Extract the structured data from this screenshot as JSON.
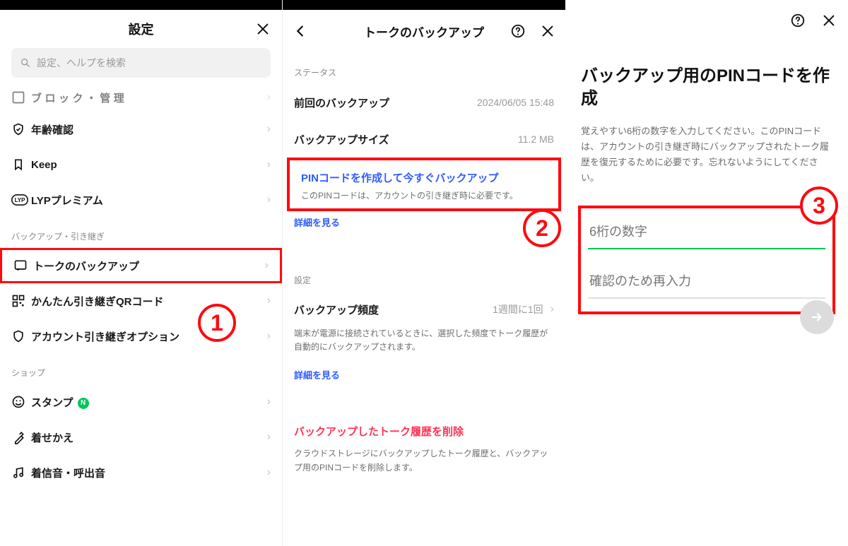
{
  "panel1": {
    "title": "設定",
    "search_placeholder": "設定、ヘルプを検索",
    "items_top": [
      {
        "icon": "blocked-icon",
        "label": "ブロック・管理"
      },
      {
        "icon": "shield-icon",
        "label": "年齢確認"
      },
      {
        "icon": "bookmark-icon",
        "label": "Keep"
      },
      {
        "icon": "lyp-icon",
        "label": "LYPプレミアム"
      }
    ],
    "section_backup_cap": "バックアップ・引き継ぎ",
    "items_backup": [
      {
        "icon": "chat-backup-icon",
        "label": "トークのバックアップ",
        "highlight": true
      },
      {
        "icon": "qr-icon",
        "label": "かんたん引き継ぎQRコード"
      },
      {
        "icon": "shield2-icon",
        "label": "アカウント引き継ぎオプション"
      }
    ],
    "section_shop_cap": "ショップ",
    "items_shop": [
      {
        "icon": "smile-icon",
        "label": "スタンプ",
        "badge": "N"
      },
      {
        "icon": "palette-icon",
        "label": "着せかえ"
      },
      {
        "icon": "music-icon",
        "label": "着信音・呼出音"
      }
    ]
  },
  "panel2": {
    "title": "トークのバックアップ",
    "status_cap": "ステータス",
    "last_label": "前回のバックアップ",
    "last_value": "2024/06/05 15:48",
    "size_label": "バックアップサイズ",
    "size_value": "11.2 MB",
    "action_title": "PINコードを作成して今すぐバックアップ",
    "action_sub": "このPINコードは、アカウントの引き継ぎ時に必要です。",
    "more_link": "詳細を見る",
    "settings_cap": "設定",
    "freq_label": "バックアップ頻度",
    "freq_value": "1週間に1回",
    "freq_desc": "端末が電源に接続されているときに、選択した頻度でトーク履歴が自動的にバックアップされます。",
    "more_link_2": "詳細を見る",
    "delete_title": "バックアップしたトーク履歴を削除",
    "delete_desc": "クラウドストレージにバックアップしたトーク履歴と、バックアップ用のPINコードを削除します。"
  },
  "panel3": {
    "heading": "バックアップ用のPINコードを作成",
    "desc": "覚えやすい6桁の数字を入力してください。このPINコードは、アカウントの引き継ぎ時にバックアップされたトーク履歴を復元するために必要です。忘れないようにしてください。",
    "ph1": "6桁の数字",
    "ph2": "確認のため再入力"
  },
  "callouts": {
    "c1": "1",
    "c2": "2",
    "c3": "3"
  }
}
